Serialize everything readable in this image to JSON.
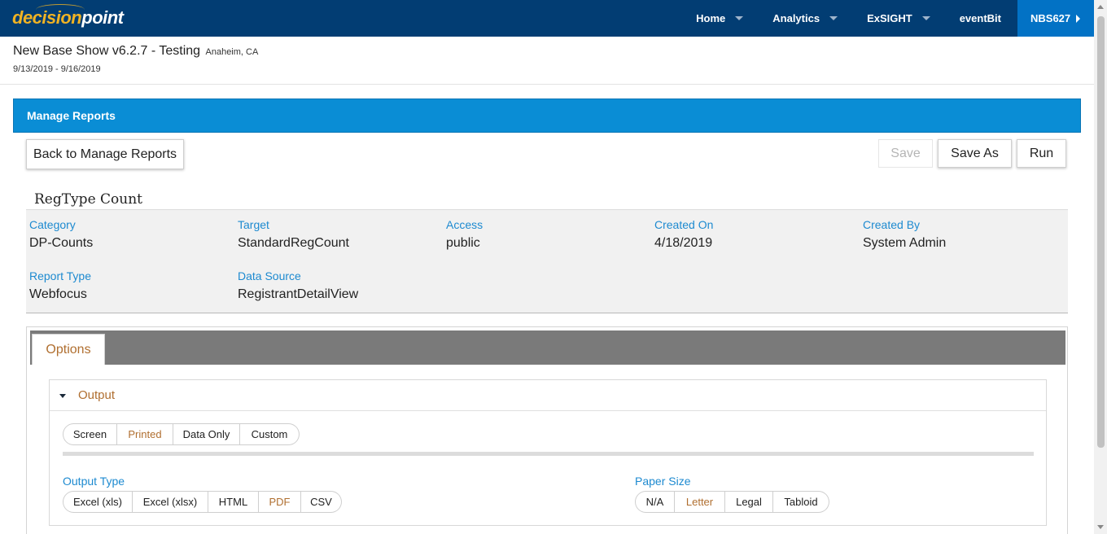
{
  "topbar": {
    "logo_part1": "decision",
    "logo_part2": "point",
    "nav": [
      {
        "label": "Home"
      },
      {
        "label": "Analytics"
      },
      {
        "label": "ExSIGHT"
      },
      {
        "label": "eventBit"
      },
      {
        "label": "NBS627"
      }
    ],
    "colors": {
      "bar": "#023d73",
      "user": "#0272c5",
      "logo_accent": "#f0b323"
    }
  },
  "show": {
    "title": "New Base Show v6.2.7 - Testing",
    "location": "Anaheim, CA",
    "dates": "9/13/2019 - 9/16/2019"
  },
  "section": {
    "title": "Manage Reports"
  },
  "actions": {
    "back": "Back to Manage Reports",
    "save": "Save",
    "save_as": "Save As",
    "run": "Run"
  },
  "report": {
    "name": "RegType Count",
    "fields": [
      {
        "label": "Category",
        "value": "DP-Counts"
      },
      {
        "label": "Target",
        "value": "StandardRegCount"
      },
      {
        "label": "Access",
        "value": "public"
      },
      {
        "label": "Created On",
        "value": "4/18/2019"
      },
      {
        "label": "Created By",
        "value": "System Admin"
      },
      {
        "label": "Report Type",
        "value": "Webfocus"
      },
      {
        "label": "Data Source",
        "value": "RegistrantDetailView"
      }
    ]
  },
  "tabs": {
    "options": "Options"
  },
  "output": {
    "title": "Output",
    "modes": [
      "Screen",
      "Printed",
      "Data Only",
      "Custom"
    ],
    "mode_selected": "Printed",
    "output_type_label": "Output Type",
    "output_types": [
      "Excel (xls)",
      "Excel (xlsx)",
      "HTML",
      "PDF",
      "CSV"
    ],
    "output_type_selected": "PDF",
    "paper_size_label": "Paper Size",
    "paper_sizes": [
      "N/A",
      "Letter",
      "Legal",
      "Tabloid"
    ],
    "paper_size_selected": "Letter"
  }
}
